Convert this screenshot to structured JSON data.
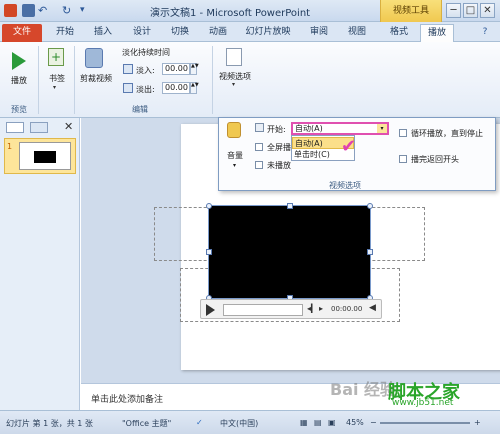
{
  "window": {
    "title": "演示文稿1 - Microsoft PowerPoint",
    "context_tab": "视频工具",
    "controls": [
      "─",
      "□",
      "✕"
    ]
  },
  "tabs": [
    "文件",
    "开始",
    "插入",
    "设计",
    "切换",
    "动画",
    "幻灯片放映",
    "审阅",
    "视图",
    "格式",
    "播放"
  ],
  "ribbon": {
    "preview_group": {
      "button": "播放",
      "label": "预览"
    },
    "bookmarks_button": "书签",
    "editing_group": {
      "trim_button": "剪裁视频",
      "fade_title": "淡化持续时间",
      "fade_in_label": "淡入:",
      "fade_in_value": "00.00",
      "fade_out_label": "淡出:",
      "fade_out_value": "00.00",
      "label": "编辑"
    },
    "video_options_button": "视频选项"
  },
  "video_options": {
    "volume": "音量",
    "start_label": "开始:",
    "start_value": "自动(A)",
    "start_options": [
      "自动(A)",
      "单击时(C)"
    ],
    "fullscreen": "全屏播",
    "hide": "未播放",
    "loop": "循环播放，直到停止",
    "rewind": "播完返回开头",
    "group_label": "视频选项"
  },
  "slides_panel": {
    "slide_number": "1"
  },
  "player": {
    "time": "00:00.00"
  },
  "notes": {
    "placeholder": "单击此处添加备注"
  },
  "status": {
    "slide_info": "幻灯片 第 1 张，共 1 张",
    "theme": "\"Office 主题\"",
    "language": "中文(中国)",
    "zoom": "45%"
  },
  "watermark": {
    "site": "脚本之家",
    "url": "www.jb51.net",
    "baidu": "Bai 经验"
  },
  "colors": {
    "file_tab": "#d6472b",
    "context_tab": "#f0c850",
    "highlight": "#e050b0"
  }
}
